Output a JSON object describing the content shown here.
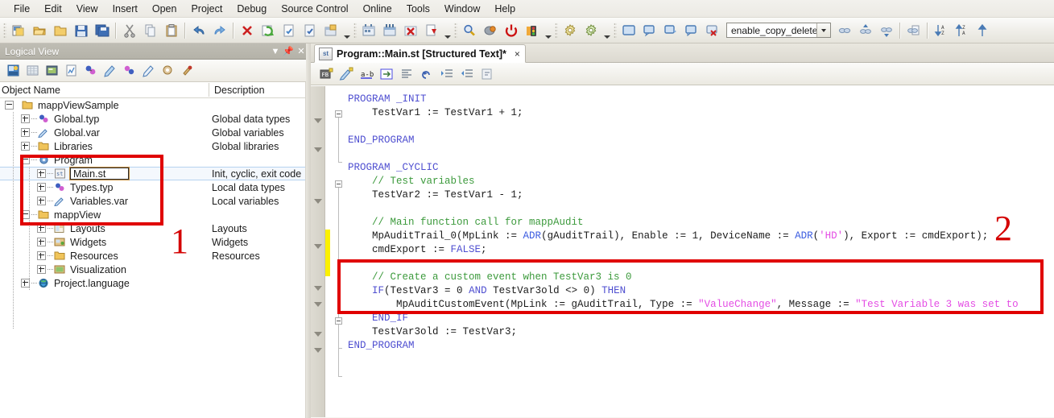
{
  "menubar": {
    "items": [
      {
        "label": "File"
      },
      {
        "label": "Edit"
      },
      {
        "label": "View"
      },
      {
        "label": "Insert"
      },
      {
        "label": "Open"
      },
      {
        "label": "Project"
      },
      {
        "label": "Debug"
      },
      {
        "label": "Source Control"
      },
      {
        "label": "Online"
      },
      {
        "label": "Tools"
      },
      {
        "label": "Window"
      },
      {
        "label": "Help"
      }
    ]
  },
  "toolbar": {
    "combo_value": "enable_copy_delete",
    "icons": [
      "new-project-icon",
      "open-folder-icon",
      "open-folder-alt-icon",
      "save-icon",
      "save-all-icon",
      "cut-icon",
      "copy-icon",
      "paste-icon",
      "undo-icon",
      "redo-icon",
      "delete-icon",
      "refresh-icon",
      "check-document-icon",
      "check-document-alt-icon",
      "properties-icon",
      "build-icon",
      "rebuild-icon",
      "clean-icon",
      "transfer-icon",
      "search-icon",
      "simulate-icon",
      "power-icon",
      "traffic-light-icon",
      "settings-gear-icon",
      "settings-gear-alt-icon",
      "window-icon",
      "output-window-icon",
      "message-window-icon",
      "comment-window-icon",
      "close-window-icon",
      "bookmark-icon",
      "bookmark-next-icon",
      "bookmark-prev-icon",
      "bookmark-clear-icon",
      "sort-asc-icon",
      "sort-desc-icon",
      "arrow-up-icon"
    ]
  },
  "left_panel": {
    "title": "Logical View",
    "title_icons": [
      "chevron-down-icon",
      "pin-icon",
      "close-icon"
    ],
    "tool_icons": [
      "logical-view-icon",
      "physical-view-icon",
      "configuration-view-icon",
      "chart-icon",
      "data-types-icon",
      "variables-icon",
      "types-alt-icon",
      "properties-icon",
      "refresh-icon",
      "tools-icon"
    ],
    "columns": {
      "name": "Object Name",
      "description": "Description"
    },
    "tree": [
      {
        "label": "mappViewSample",
        "desc": "",
        "depth": 0,
        "icon": "folder-icon",
        "expander": "minus"
      },
      {
        "label": "Global.typ",
        "desc": "Global data types",
        "depth": 1,
        "icon": "data-types-icon",
        "expander": "plus"
      },
      {
        "label": "Global.var",
        "desc": "Global variables",
        "depth": 1,
        "icon": "variables-icon",
        "expander": "plus"
      },
      {
        "label": "Libraries",
        "desc": "Global libraries",
        "depth": 1,
        "icon": "folder-icon",
        "expander": "plus"
      },
      {
        "label": "Program",
        "desc": "",
        "depth": 1,
        "icon": "program-icon",
        "expander": "minus"
      },
      {
        "label": "Main.st",
        "desc": "Init, cyclic, exit code",
        "depth": 2,
        "icon": "st-file-icon",
        "expander": "plus",
        "selected": true,
        "editing": true
      },
      {
        "label": "Types.typ",
        "desc": "Local data types",
        "depth": 2,
        "icon": "data-types-icon",
        "expander": "plus"
      },
      {
        "label": "Variables.var",
        "desc": "Local variables",
        "depth": 2,
        "icon": "variables-icon",
        "expander": "plus"
      },
      {
        "label": "mappView",
        "desc": "",
        "depth": 1,
        "icon": "folder-icon",
        "expander": "minus"
      },
      {
        "label": "Layouts",
        "desc": "Layouts",
        "depth": 2,
        "icon": "layouts-icon",
        "expander": "plus"
      },
      {
        "label": "Widgets",
        "desc": "Widgets",
        "depth": 2,
        "icon": "widgets-icon",
        "expander": "plus"
      },
      {
        "label": "Resources",
        "desc": "Resources",
        "depth": 2,
        "icon": "folder-icon",
        "expander": "plus"
      },
      {
        "label": "Visualization",
        "desc": "",
        "depth": 2,
        "icon": "visualization-icon",
        "expander": "plus"
      },
      {
        "label": "Project.language",
        "desc": "",
        "depth": 1,
        "icon": "globe-icon",
        "expander": "plus"
      }
    ]
  },
  "editor": {
    "tab": {
      "icon": "st-file-icon",
      "icon_text": "st",
      "title": "Program::Main.st [Structured Text]*",
      "close": "×"
    },
    "tool_icons": [
      "function-block-icon",
      "variable-icon",
      "replace-icon",
      "goto-icon",
      "align-icon",
      "undo-edit-icon",
      "indent-icon",
      "outdent-icon",
      "comment-icon"
    ],
    "code_lines": [
      {
        "indent": 0,
        "segments": [
          {
            "t": "PROGRAM _INIT",
            "c": "kw"
          }
        ]
      },
      {
        "indent": 0,
        "segments": [
          {
            "t": "    TestVar1 := TestVar1 + 1;",
            "c": ""
          }
        ]
      },
      {
        "indent": 0,
        "segments": [
          {
            "t": "",
            "c": ""
          }
        ]
      },
      {
        "indent": 0,
        "segments": [
          {
            "t": "END_PROGRAM",
            "c": "kw"
          }
        ]
      },
      {
        "indent": 0,
        "segments": [
          {
            "t": "",
            "c": ""
          }
        ]
      },
      {
        "indent": 0,
        "segments": [
          {
            "t": "PROGRAM _CYCLIC",
            "c": "kw"
          }
        ]
      },
      {
        "indent": 0,
        "segments": [
          {
            "t": "    // Test variables",
            "c": "cmt"
          }
        ]
      },
      {
        "indent": 0,
        "segments": [
          {
            "t": "    TestVar2 := TestVar1 - 1;",
            "c": ""
          }
        ]
      },
      {
        "indent": 0,
        "segments": [
          {
            "t": "",
            "c": ""
          }
        ]
      },
      {
        "indent": 0,
        "segments": [
          {
            "t": "    // Main function call for mappAudit",
            "c": "cmt"
          }
        ]
      },
      {
        "indent": 0,
        "segments": [
          {
            "t": "    MpAuditTrail_0(MpLink := ",
            "c": ""
          },
          {
            "t": "ADR",
            "c": "fn"
          },
          {
            "t": "(gAuditTrail), Enable := 1, DeviceName := ",
            "c": ""
          },
          {
            "t": "ADR",
            "c": "fn"
          },
          {
            "t": "(",
            "c": ""
          },
          {
            "t": "'HD'",
            "c": "str"
          },
          {
            "t": "), Export := cmdExport);",
            "c": ""
          }
        ]
      },
      {
        "indent": 0,
        "segments": [
          {
            "t": "    cmdExport := ",
            "c": ""
          },
          {
            "t": "FALSE",
            "c": "kw"
          },
          {
            "t": ";",
            "c": ""
          }
        ]
      },
      {
        "indent": 0,
        "segments": [
          {
            "t": "",
            "c": ""
          }
        ]
      },
      {
        "indent": 0,
        "segments": [
          {
            "t": "    // Create a custom event when TestVar3 is 0",
            "c": "cmt"
          }
        ]
      },
      {
        "indent": 0,
        "segments": [
          {
            "t": "    ",
            "c": ""
          },
          {
            "t": "IF",
            "c": "kw"
          },
          {
            "t": "(TestVar3 = 0 ",
            "c": ""
          },
          {
            "t": "AND",
            "c": "kw"
          },
          {
            "t": " TestVar3old <> 0) ",
            "c": ""
          },
          {
            "t": "THEN",
            "c": "kw"
          }
        ]
      },
      {
        "indent": 0,
        "segments": [
          {
            "t": "        MpAuditCustomEvent(MpLink := gAuditTrail, Type := ",
            "c": ""
          },
          {
            "t": "\"ValueChange\"",
            "c": "str"
          },
          {
            "t": ", Message := ",
            "c": ""
          },
          {
            "t": "\"Test Variable 3 was set to",
            "c": "str"
          }
        ]
      },
      {
        "indent": 0,
        "segments": [
          {
            "t": "    ",
            "c": ""
          },
          {
            "t": "END_IF",
            "c": "kw"
          }
        ]
      },
      {
        "indent": 0,
        "segments": [
          {
            "t": "    TestVar3old := TestVar3;",
            "c": ""
          }
        ]
      },
      {
        "indent": 0,
        "segments": [
          {
            "t": "END_PROGRAM",
            "c": "kw"
          }
        ]
      }
    ]
  },
  "annotations": [
    {
      "label": "1",
      "name": "annotation-number-1"
    },
    {
      "label": "2",
      "name": "annotation-number-2"
    }
  ],
  "colors": {
    "annotation_red": "#e00000",
    "keyword": "#4f4fd0",
    "comment": "#3c9a3c",
    "string": "#e44ce4",
    "function": "#3b5ce0",
    "change_bar": "#fbf000"
  }
}
